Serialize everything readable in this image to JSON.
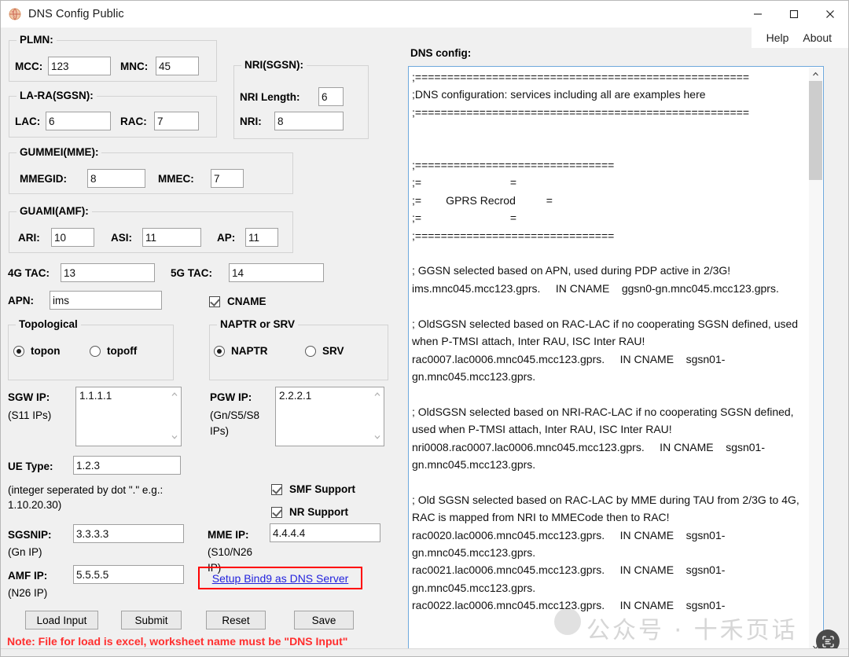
{
  "window": {
    "title": "DNS Config Public",
    "icon": "globe-network-icon",
    "minimize": "–",
    "maximize": "□",
    "close": "✕"
  },
  "menu": {
    "help": "Help",
    "about": "About"
  },
  "groups": {
    "plmn": {
      "title": "PLMN:",
      "mcc_label": "MCC:",
      "mcc_value": "123",
      "mnc_label": "MNC:",
      "mnc_value": "45"
    },
    "lara": {
      "title": "LA-RA(SGSN):",
      "lac_label": "LAC:",
      "lac_value": "6",
      "rac_label": "RAC:",
      "rac_value": "7"
    },
    "nri": {
      "title": "NRI(SGSN):",
      "nri_length_label": "NRI Length:",
      "nri_length_value": "6",
      "nri_label": "NRI:",
      "nri_value": "8"
    },
    "gummei": {
      "title": "GUMMEI(MME):",
      "mmegid_label": "MMEGID:",
      "mmegid_value": "8",
      "mmec_label": "MMEC:",
      "mmec_value": "7"
    },
    "guami": {
      "title": "GUAMI(AMF):",
      "ari_label": "ARI:",
      "ari_value": "10",
      "asi_label": "ASI:",
      "asi_value": "11",
      "ap_label": "AP:",
      "ap_value": "11"
    },
    "topological": {
      "title": "Topological",
      "topon_label": "topon",
      "topoff_label": "topoff",
      "selected": "topon"
    },
    "naptr_srv": {
      "title": "NAPTR or SRV",
      "naptr_label": "NAPTR",
      "srv_label": "SRV",
      "selected": "NAPTR"
    }
  },
  "fields": {
    "tac4g_label": "4G TAC:",
    "tac4g_value": "13",
    "tac5g_label": "5G TAC:",
    "tac5g_value": "14",
    "apn_label": "APN:",
    "apn_value": "ims",
    "cname_label": "CNAME",
    "cname_checked": true,
    "sgw_label": "SGW IP:",
    "sgw_sub": "(S11 IPs)",
    "sgw_value": "1.1.1.1",
    "pgw_label": "PGW IP:",
    "pgw_sub_1": "(Gn/S5/S8",
    "pgw_sub_2": "IPs)",
    "pgw_value": "2.2.2.1",
    "ue_type_label": "UE Type:",
    "ue_type_value": "1.2.3",
    "ue_hint_1": "(integer seperated by dot \".\" e.g.:",
    "ue_hint_2": "1.10.20.30)",
    "smf_label": "SMF Support",
    "smf_checked": true,
    "nr_label": "NR Support",
    "nr_checked": true,
    "sgsnip_label": "SGSNIP:",
    "sgsnip_sub": "(Gn IP)",
    "sgsnip_value": "3.3.3.3",
    "mmeip_label": "MME IP:",
    "mmeip_sub_1": "(S10/N26",
    "mmeip_sub_2": "IP)",
    "mmeip_value": "4.4.4.4",
    "amfip_label": "AMF IP:",
    "amfip_sub": "(N26 IP)",
    "amfip_value": "5.5.5.5",
    "bind9_link": "Setup Bind9 as DNS Server"
  },
  "buttons": {
    "load_input": "Load Input",
    "submit": "Submit",
    "reset": "Reset",
    "save": "Save"
  },
  "note": "Note: File for load is excel, worksheet name must be \"DNS Input\"",
  "dns": {
    "label": "DNS config:",
    "content": ";====================================================\n;DNS configuration: services including all are examples here\n;====================================================\n\n\n;===============================\n;=                             =\n;=        GPRS Recrod          =\n;=                             =\n;===============================\n\n; GGSN selected based on APN, used during PDP active in 2/3G!\nims.mnc045.mcc123.gprs.     IN CNAME    ggsn0-gn.mnc045.mcc123.gprs.\n\n; OldSGSN selected based on RAC-LAC if no cooperating SGSN defined, used when P-TMSI attach, Inter RAU, ISC Inter RAU!\nrac0007.lac0006.mnc045.mcc123.gprs.     IN CNAME    sgsn01-gn.mnc045.mcc123.gprs.\n\n; OldSGSN selected based on NRI-RAC-LAC if no cooperating SGSN defined, used when P-TMSI attach, Inter RAU, ISC Inter RAU!\nnri0008.rac0007.lac0006.mnc045.mcc123.gprs.     IN CNAME    sgsn01-gn.mnc045.mcc123.gprs.\n\n; Old SGSN selected based on RAC-LAC by MME during TAU from 2/3G to 4G, RAC is mapped from NRI to MMECode then to RAC!\nrac0020.lac0006.mnc045.mcc123.gprs.     IN CNAME    sgsn01-gn.mnc045.mcc123.gprs.\nrac0021.lac0006.mnc045.mcc123.gprs.     IN CNAME    sgsn01-gn.mnc045.mcc123.gprs.\nrac0022.lac0006.mnc045.mcc123.gprs.     IN CNAME    sgsn01-"
  },
  "watermark": {
    "text": "公众号 · 十禾页话"
  },
  "floating": {
    "icon": "ocr-scan-icon"
  }
}
